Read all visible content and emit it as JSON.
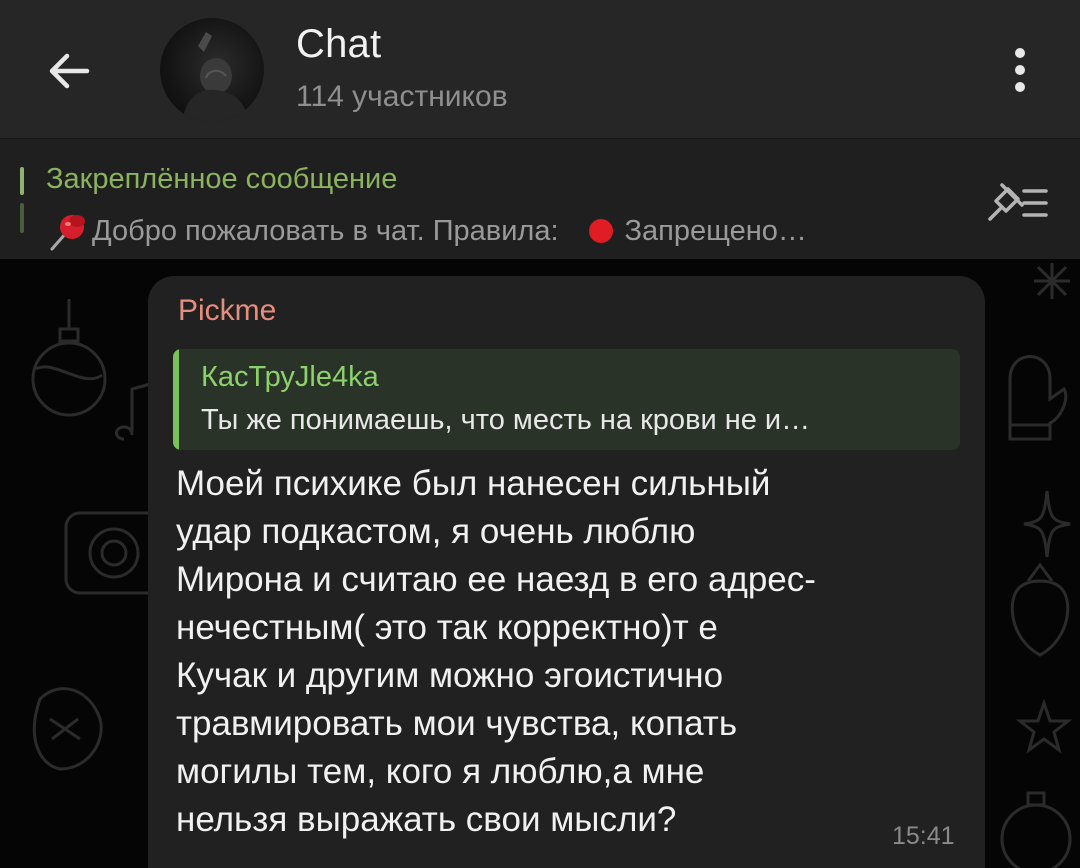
{
  "header": {
    "title": "Chat",
    "subtitle": "114 участников",
    "back_icon": "arrow-left-icon",
    "menu_icon": "more-vertical-icon"
  },
  "pinned": {
    "title": "Закреплённое сообщение",
    "text_part1": "Добро пожаловать в чат. Правила:",
    "text_part2": "Запрещено…",
    "pin_icon": "pushpin-icon",
    "dot_icon": "red-circle-icon",
    "list_icon": "pinned-list-icon"
  },
  "message": {
    "sender": "Pickme",
    "reply_author": "КасТруJle4ka",
    "reply_text": "Ты же понимаешь, что месть на крови не и…",
    "text": "Моей психике был нанесен сильный\nудар подкастом, я очень люблю\nМирона и считаю ее наезд в его адрес-\nнечестным( это так корректно)т е\nКучак и другим можно эгоистично\nтравмировать мои чувства, копать\nмогилы тем, кого я люблю,а мне\nнельзя выражать свои мысли?",
    "time": "15:41"
  },
  "colors": {
    "header_bg": "#262626",
    "pinned_bg": "#1f1f1f",
    "accent_green": "#8bb25f",
    "sender_color": "#e68d7e",
    "reply_bg": "#293327",
    "bubble_bg": "#212121"
  }
}
